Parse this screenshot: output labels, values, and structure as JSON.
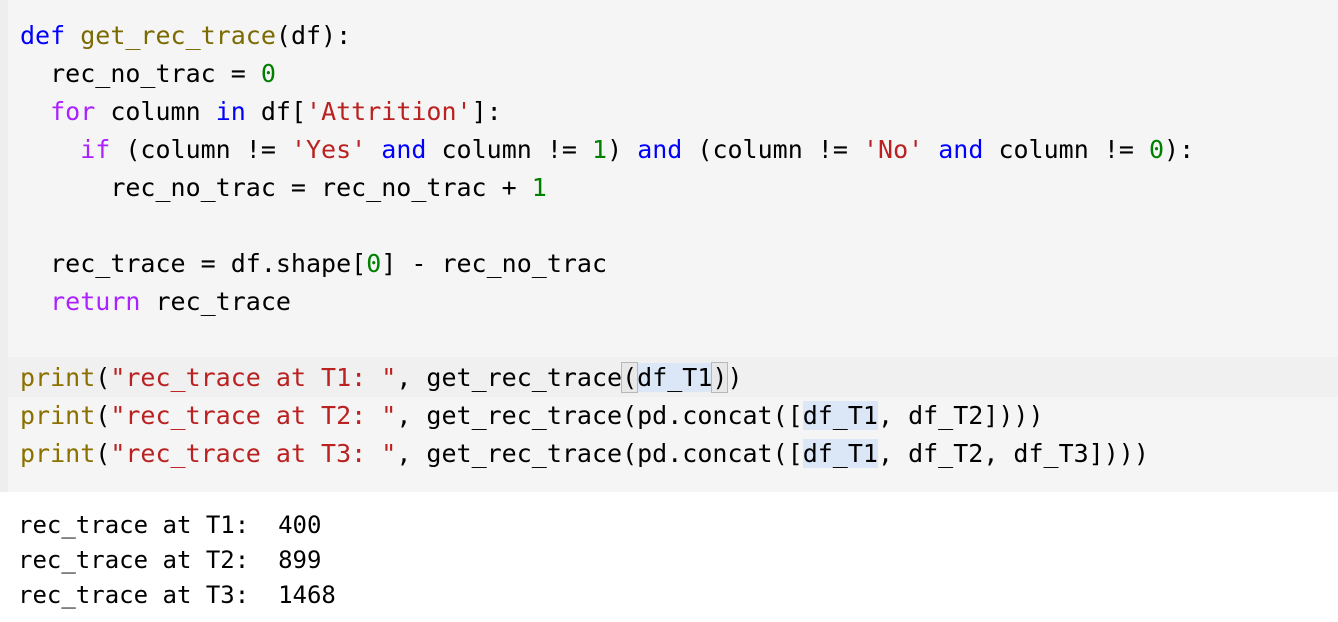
{
  "code": {
    "def_kw": "def",
    "func_name": "get_rec_trace",
    "func_sig": "(df):",
    "line2_a": "rec_no_trac",
    "line2_b": " = ",
    "line2_c": "0",
    "line3_for": "for",
    "line3_a": " column ",
    "line3_in": "in",
    "line3_b": " df[",
    "line3_str": "'Attrition'",
    "line3_c": "]:",
    "line4_if": "if",
    "line4_a": " (column != ",
    "line4_yes": "'Yes'",
    "line4_and1": "and",
    "line4_b": " column != ",
    "line4_one": "1",
    "line4_c": ") ",
    "line4_and2": "and",
    "line4_d": " (column != ",
    "line4_no": "'No'",
    "line4_and3": "and",
    "line4_e": " column != ",
    "line4_zero": "0",
    "line4_f": "):",
    "line5_a": "rec_no_trac = rec_no_trac + ",
    "line5_one": "1",
    "line7_a": "rec_trace = df.shape[",
    "line7_zero": "0",
    "line7_b": "] - rec_no_trac",
    "line8_return": "return",
    "line8_a": " rec_trace",
    "print_kw": "print",
    "p1_open": "(",
    "p1_str": "\"rec_trace at T1: \"",
    "p1_mid": ", get_rec_trace",
    "p1_lparen": "(",
    "p1_arg": "df_T1",
    "p1_rparen": ")",
    "p1_end": ")",
    "p2_str": "\"rec_trace at T2: \"",
    "p2_mid": ", get_rec_trace(pd.concat([",
    "p2_arg": "df_T1",
    "p2_end": ", df_T2])))",
    "p3_str": "\"rec_trace at T3: \"",
    "p3_mid": ", get_rec_trace(pd.concat([",
    "p3_arg": "df_T1",
    "p3_end": ", df_T2, df_T3])))"
  },
  "output": {
    "line1": "rec_trace at T1:  400",
    "line2": "rec_trace at T2:  899",
    "line3": "rec_trace at T3:  1468"
  }
}
